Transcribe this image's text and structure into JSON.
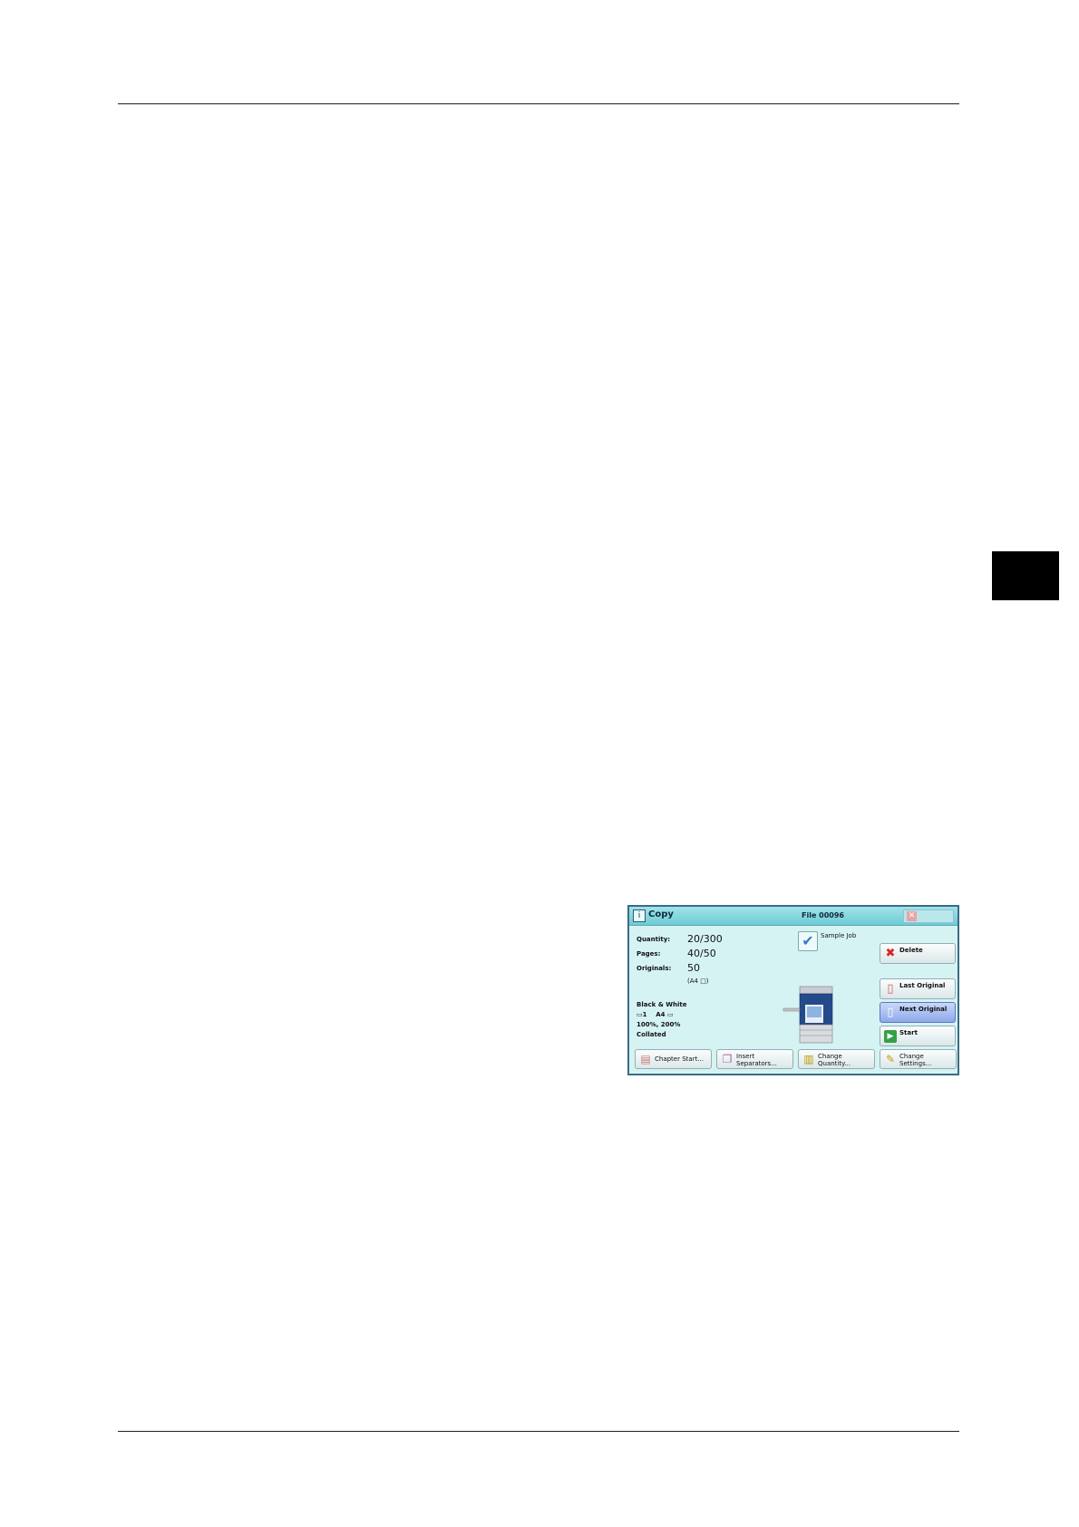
{
  "window": {
    "title": "Copy",
    "file": "File 00096",
    "title_icon": "info-icon"
  },
  "status": {
    "quantity_label": "Quantity:",
    "quantity_value": "20/300",
    "pages_label": "Pages:",
    "pages_value": "40/50",
    "originals_label": "Originals:",
    "originals_value": "50",
    "originals_size": "(A4 □)",
    "color_mode": "Black & White",
    "tray": "▭1    A4 ▭",
    "reduce_enlarge": "100%, 200%",
    "output": "Collated"
  },
  "sample_job": {
    "label": "Sample Job",
    "checked": true
  },
  "side_buttons": {
    "delete": "Delete",
    "last_original": "Last Original",
    "next_original": "Next Original",
    "start": "Start"
  },
  "bottom_buttons": {
    "chapter_start": "Chapter Start...",
    "insert_separators_1": "Insert",
    "insert_separators_2": "Separators...",
    "change_quantity_1": "Change",
    "change_quantity_2": "Quantity...",
    "change_settings_1": "Change",
    "change_settings_2": "Settings..."
  },
  "colors": {
    "screen_bg": "#d6f3f4",
    "titlebar": "#6fcbd6",
    "active_button": "#8ea9ea"
  }
}
